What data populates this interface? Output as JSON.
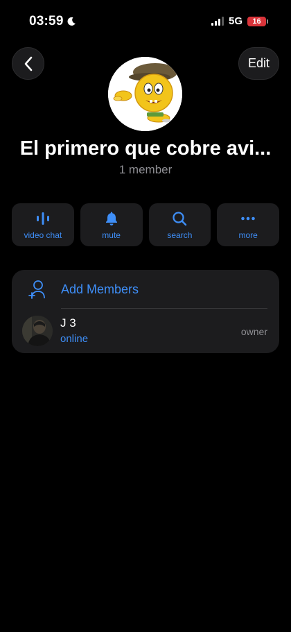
{
  "status_bar": {
    "time": "03:59",
    "network": "5G",
    "battery": "16"
  },
  "header": {
    "edit_label": "Edit"
  },
  "group": {
    "title": "El primero que cobre avi...",
    "subtitle": "1 member"
  },
  "actions": [
    {
      "label": "video chat",
      "icon": "waveform-icon"
    },
    {
      "label": "mute",
      "icon": "bell-icon"
    },
    {
      "label": "search",
      "icon": "search-icon"
    },
    {
      "label": "more",
      "icon": "ellipsis-icon"
    }
  ],
  "members": {
    "add_label": "Add Members",
    "list": [
      {
        "name": "J 3",
        "status": "online",
        "role": "owner"
      }
    ]
  },
  "colors": {
    "accent": "#3e8ef7",
    "background": "#000000",
    "card": "#1c1c1e",
    "secondary_text": "#8e8e93",
    "battery_low": "#d9343a"
  }
}
